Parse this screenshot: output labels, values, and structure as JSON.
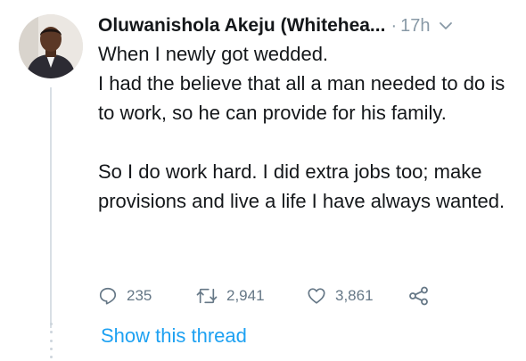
{
  "tweet": {
    "author_name": "Oluwanishola Akeju (Whitehea...",
    "separator": "·",
    "time": "17h",
    "text": "When I newly got wedded.\nI had the believe that all a man needed to do is to work, so he can provide for his family.\n\nSo I do work hard. I did extra jobs too; make provisions and live a life I have always wanted."
  },
  "actions": {
    "reply_count": "235",
    "retweet_count": "2,941",
    "like_count": "3,861"
  },
  "icons": {
    "more": "chevron-down-icon",
    "reply": "reply-icon",
    "retweet": "retweet-icon",
    "like": "heart-icon",
    "share": "share-icon"
  },
  "show_thread_label": "Show this thread",
  "colors": {
    "link": "#1da1f2",
    "secondary_text": "#8899a6",
    "action_icon": "#657786"
  }
}
